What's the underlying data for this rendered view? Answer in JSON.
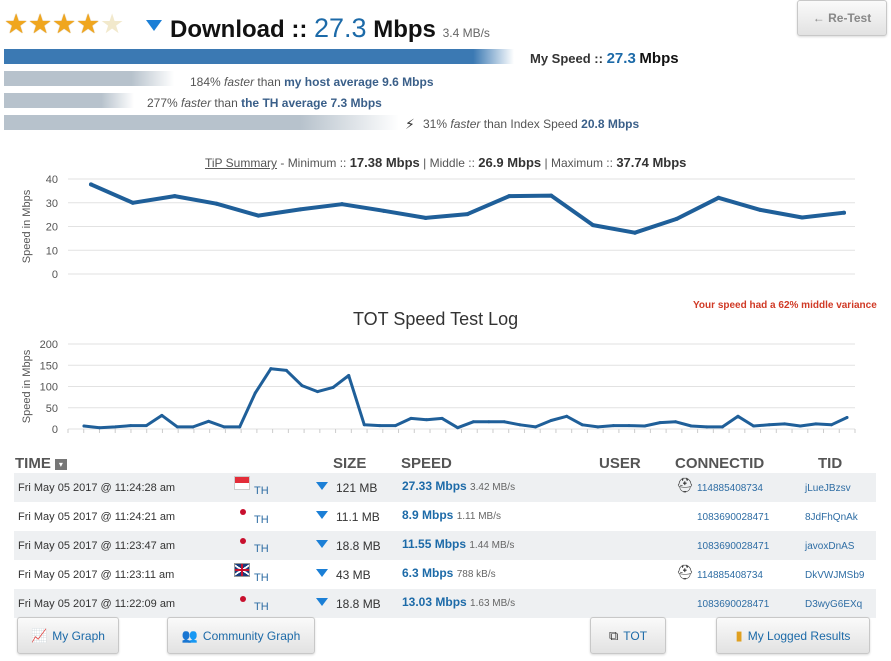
{
  "header": {
    "rating": 4,
    "rating_max": 5,
    "title_prefix": "Download ::",
    "speed_value": "27.3",
    "speed_unit": "Mbps",
    "speed_mbs": "3.4 MB/s",
    "retest_label": "← Re-Test"
  },
  "my_speed": {
    "label": "My Speed ::",
    "value": "27.3",
    "unit": "Mbps"
  },
  "comparisons": [
    {
      "percent": "184%",
      "faster": "faster",
      "than": "than",
      "target": "my host average 9.6 Mbps",
      "bar_fraction": 0.33
    },
    {
      "percent": "277%",
      "faster": "faster",
      "than": "than",
      "target": "the TH average 7.3 Mbps",
      "bar_fraction": 0.25
    },
    {
      "percent": "31%",
      "faster": "faster",
      "than": "than Index Speed",
      "target": "20.8 Mbps",
      "bar_fraction": 0.77
    }
  ],
  "summary": {
    "link": "TiP Summary",
    "min_label": "- Minimum ::",
    "min_value": "17.38 Mbps",
    "mid_label": "| Middle ::",
    "mid_value": "26.9 Mbps",
    "max_label": "| Maximum ::",
    "max_value": "37.74 Mbps"
  },
  "variance_note": "Your speed had a 62% middle variance",
  "log_title": "TOT Speed Test Log",
  "chart_data": [
    {
      "type": "line",
      "title": "",
      "xlabel": "",
      "ylabel": "Speed in Mbps",
      "ylim": [
        0,
        40
      ],
      "yticks": [
        0,
        10,
        20,
        30,
        40
      ],
      "grid": true,
      "color": "#1f5f99",
      "series": [
        {
          "values": [
            37.74,
            30,
            32.8,
            29.6,
            24.6,
            27.2,
            29.4,
            26.6,
            23.6,
            25.2,
            32.8,
            33,
            20.6,
            17.38,
            23.2,
            32.1,
            27,
            23.8,
            25.8
          ]
        }
      ]
    },
    {
      "type": "line",
      "title": "TOT Speed Test Log",
      "xlabel": "",
      "ylabel": "Speed in Mbps",
      "ylim": [
        0,
        200
      ],
      "yticks": [
        0,
        50,
        100,
        150,
        200
      ],
      "grid": true,
      "color": "#1f5f99",
      "series": [
        {
          "values": [
            7,
            3,
            5,
            8,
            8,
            32,
            5,
            5,
            18,
            5,
            5,
            85,
            142,
            138,
            102,
            88,
            98,
            126,
            10,
            8,
            8,
            25,
            22,
            25,
            3,
            17,
            17,
            17,
            10,
            5,
            20,
            30,
            10,
            5,
            8,
            8,
            7,
            15,
            17,
            7,
            5,
            5,
            30,
            7,
            10,
            12,
            7,
            12,
            10,
            27
          ]
        }
      ]
    }
  ],
  "table": {
    "headers": {
      "time": "TIME",
      "sort": "▾",
      "size": "SIZE",
      "speed": "SPEED",
      "user": "USER",
      "connectid": "CONNECTID",
      "tid": "TID"
    },
    "rows": [
      {
        "time": "Fri May 05 2017 @ 11:24:28 am",
        "flag": "sg",
        "cc": "TH",
        "size": "121 MB",
        "speed": "27.33 Mbps",
        "mbs": "3.42 MB/s",
        "user_icon": true,
        "connectid": "114885408734",
        "tid": "jLueJBzsv"
      },
      {
        "time": "Fri May 05 2017 @ 11:24:21 am",
        "flag": "dot",
        "cc": "TH",
        "size": "11.1 MB",
        "speed": "8.9 Mbps",
        "mbs": "1.11 MB/s",
        "user_icon": false,
        "connectid": "1083690028471",
        "tid": "8JdFhQnAk"
      },
      {
        "time": "Fri May 05 2017 @ 11:23:47 am",
        "flag": "dot",
        "cc": "TH",
        "size": "18.8 MB",
        "speed": "11.55 Mbps",
        "mbs": "1.44 MB/s",
        "user_icon": false,
        "connectid": "1083690028471",
        "tid": "javoxDnAS"
      },
      {
        "time": "Fri May 05 2017 @ 11:23:11 am",
        "flag": "gb",
        "cc": "TH",
        "size": "43 MB",
        "speed": "6.3 Mbps",
        "mbs": "788 kB/s",
        "user_icon": true,
        "connectid": "114885408734",
        "tid": "DkVWJMSb9"
      },
      {
        "time": "Fri May 05 2017 @ 11:22:09 am",
        "flag": "dot",
        "cc": "TH",
        "size": "18.8 MB",
        "speed": "13.03 Mbps",
        "mbs": "1.63 MB/s",
        "user_icon": false,
        "connectid": "1083690028471",
        "tid": "D3wyG6EXq"
      }
    ]
  },
  "footer": {
    "my_graph": "My Graph",
    "community_graph": "Community Graph",
    "tot": "TOT",
    "logged_results": "My Logged Results"
  }
}
